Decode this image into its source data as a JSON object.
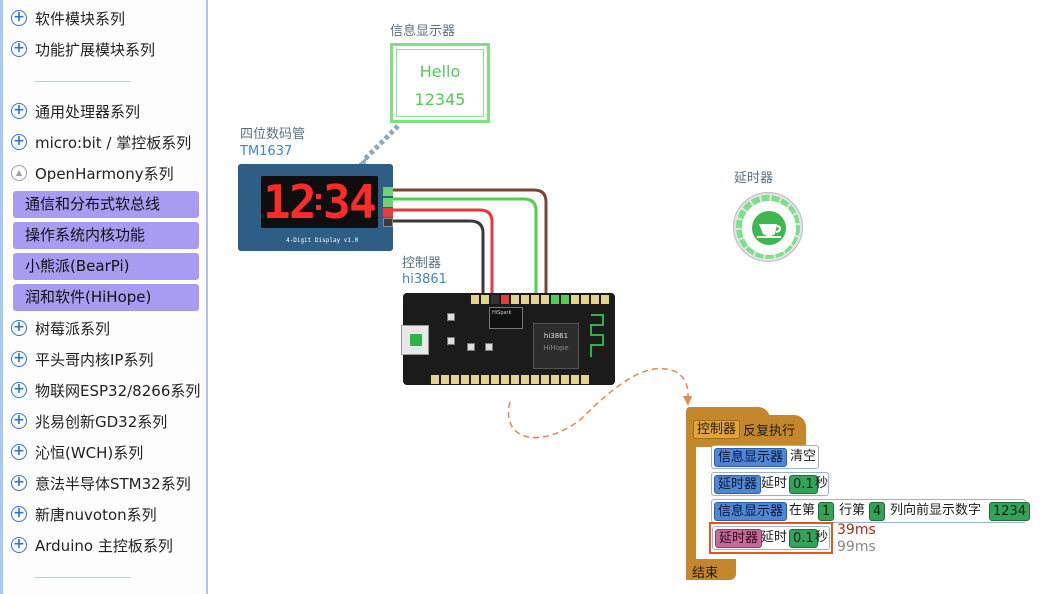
{
  "sidebar": {
    "items_top": [
      {
        "label": "软件模块系列",
        "icon": "plus-circle-icon"
      },
      {
        "label": "功能扩展模块系列",
        "icon": "plus-circle-icon"
      }
    ],
    "items_main": [
      {
        "label": "通用处理器系列",
        "icon": "plus-circle-icon"
      },
      {
        "label": "micro:bit / 掌控板系列",
        "icon": "plus-circle-icon"
      },
      {
        "label": "OpenHarmony系列",
        "icon": "collapse-arrow-icon"
      }
    ],
    "sub_items": [
      {
        "label": "通信和分布式软总线"
      },
      {
        "label": "操作系统内核功能"
      },
      {
        "label": "小熊派(BearPi)"
      },
      {
        "label": "润和软件(HiHope)"
      }
    ],
    "items_bottom": [
      {
        "label": "树莓派系列",
        "icon": "plus-circle-icon"
      },
      {
        "label": "平头哥内核IP系列",
        "icon": "plus-circle-icon"
      },
      {
        "label": "物联网ESP32/8266系列",
        "icon": "plus-circle-icon"
      },
      {
        "label": "兆易创新GD32系列",
        "icon": "plus-circle-icon"
      },
      {
        "label": "沁恒(WCH)系列",
        "icon": "plus-circle-icon"
      },
      {
        "label": "意法半导体STM32系列",
        "icon": "plus-circle-icon"
      },
      {
        "label": "新唐nuvoton系列",
        "icon": "plus-circle-icon"
      },
      {
        "label": "Arduino 主控板系列",
        "icon": "plus-circle-icon"
      }
    ]
  },
  "devices": {
    "info_display": {
      "title": "信息显示器",
      "line1": "Hello",
      "line2": "12345"
    },
    "seg_display": {
      "title": "四位数码管",
      "model": "TM1637",
      "digits": [
        "1",
        "2",
        "3",
        "4"
      ],
      "caption": "4-Digit Display   v1.0"
    },
    "controller": {
      "title": "控制器",
      "model": "hi3861",
      "chip_line1": "hi3861",
      "chip_line2": "HiHope",
      "module_label": "HiSpark"
    },
    "timer": {
      "title": "延时器"
    }
  },
  "blocks": {
    "hat_device": "控制器",
    "hat_label": "反复执行",
    "end_label": "结束",
    "stmt1": {
      "device": "信息显示器",
      "action": "清空"
    },
    "stmt2": {
      "device": "延时器",
      "action": "延时",
      "value": "0.1",
      "unit": "秒"
    },
    "stmt3": {
      "device": "信息显示器",
      "prefix": "在第",
      "row": "1",
      "mid": "行第",
      "col": "4",
      "suffix": "列向前显示数字",
      "value": "1234"
    },
    "stmt4": {
      "device": "延时器",
      "action": "延时",
      "value": "0.1",
      "unit": "秒",
      "timing1": "39ms",
      "timing2": "99ms"
    }
  },
  "colors": {
    "accent_blue": "#2d78c8",
    "sub_item_purple": "#a89cf2",
    "block_orange": "#c5872c",
    "highlight_border": "#e8541c"
  }
}
